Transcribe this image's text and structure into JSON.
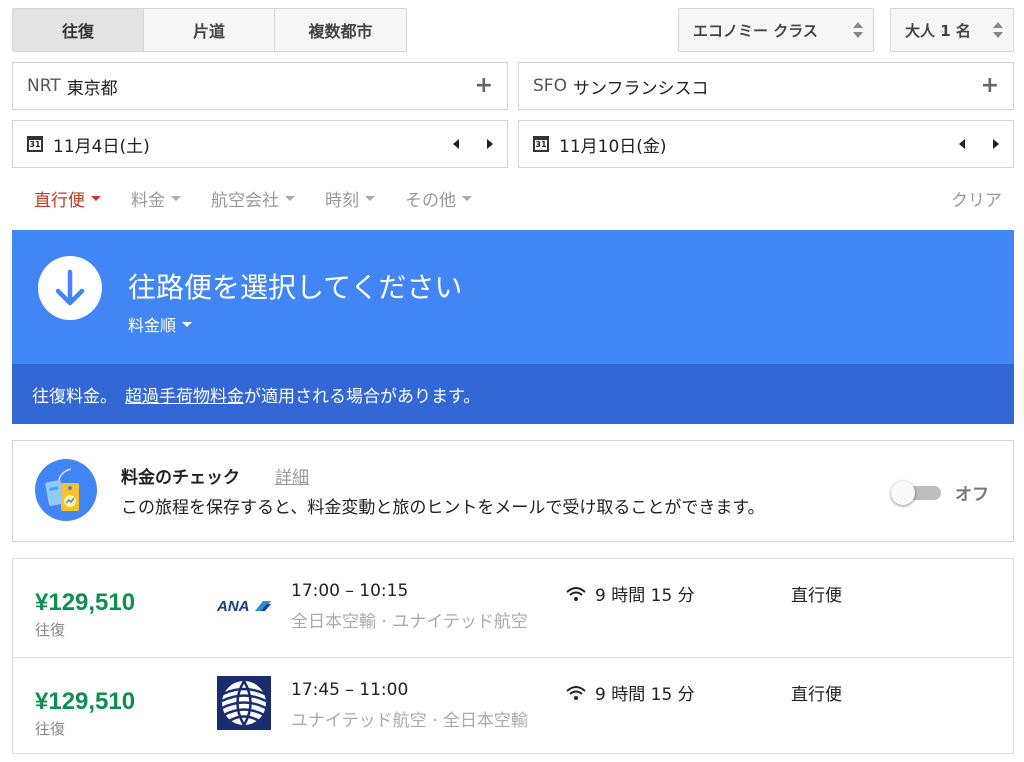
{
  "trip_type": {
    "options": [
      "往復",
      "片道",
      "複数都市"
    ],
    "selected": 0
  },
  "cabin_class": "エコノミー クラス",
  "passengers": "大人 1 名",
  "origin": {
    "code": "NRT",
    "name": "東京都"
  },
  "destination": {
    "code": "SFO",
    "name": "サンフランシスコ"
  },
  "depart_date": "11月4日(土)",
  "return_date": "11月10日(金)",
  "calendar_icon_text": "31",
  "filters": [
    {
      "label": "直行便",
      "active": true
    },
    {
      "label": "料金",
      "active": false
    },
    {
      "label": "航空会社",
      "active": false
    },
    {
      "label": "時刻",
      "active": false
    },
    {
      "label": "その他",
      "active": false
    }
  ],
  "clear_label": "クリア",
  "banner": {
    "title": "往路便を選択してください",
    "sort_label": "料金順",
    "notice_prefix": "往復料金。",
    "notice_link": "超過手荷物料金",
    "notice_suffix": "が適用される場合があります。"
  },
  "price_tracking": {
    "title": "料金のチェック",
    "link": "詳細",
    "description": "この旅程を保存すると、料金変動と旅のヒントをメールで受け取ることができます。",
    "toggle_label": "オフ",
    "enabled": false
  },
  "flights": [
    {
      "price": "¥129,510",
      "price_note": "往復",
      "logo": "ana-logo",
      "times": "17:00 – 10:15",
      "airlines": "全日本空輸 · ユナイテッド航空",
      "duration": "9 時間 15 分",
      "stops": "直行便"
    },
    {
      "price": "¥129,510",
      "price_note": "往復",
      "logo": "united-logo",
      "times": "17:45 – 11:00",
      "airlines": "ユナイテッド航空 · 全日本空輸",
      "duration": "9 時間 15 分",
      "stops": "直行便"
    }
  ],
  "colors": {
    "banner": "#4285f4",
    "notice": "#3367d6",
    "price": "#0d904f",
    "active_filter": "#c53929"
  }
}
